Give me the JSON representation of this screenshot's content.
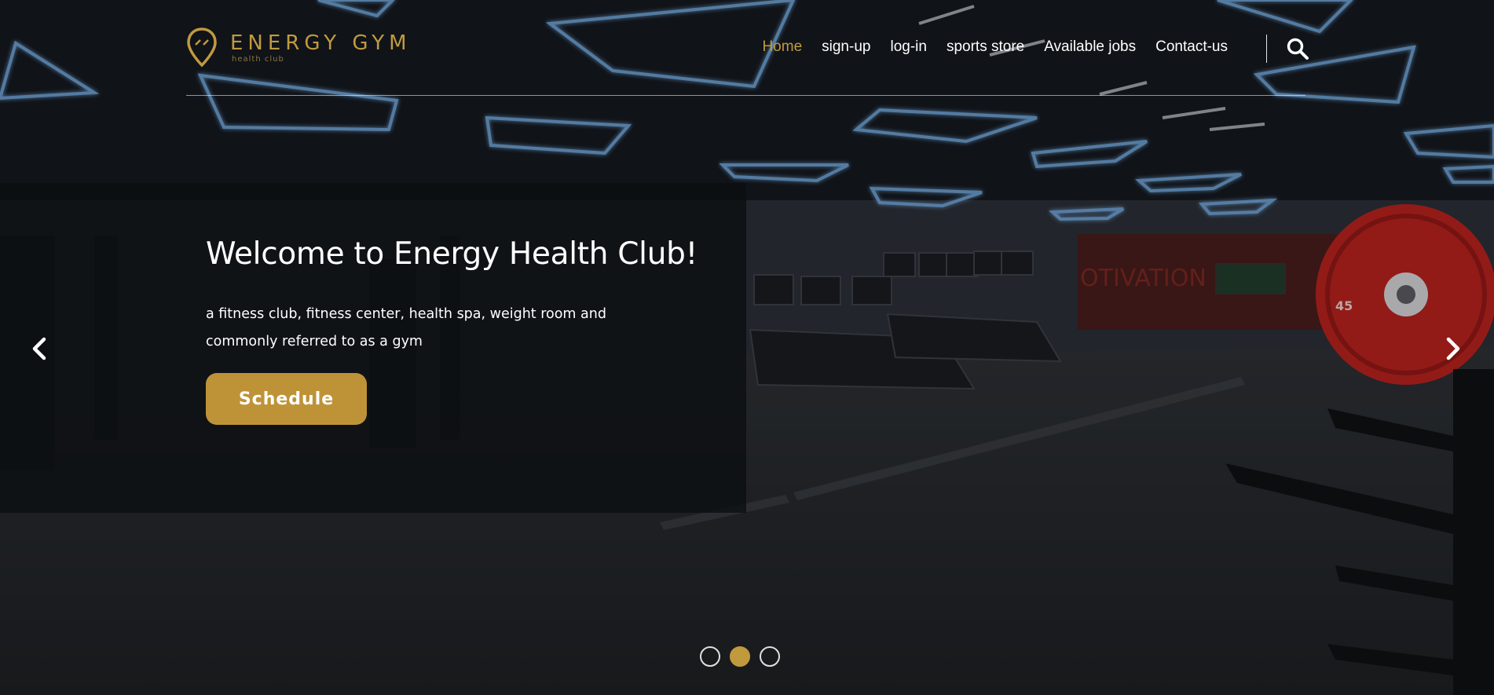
{
  "brand": {
    "name": "ENERGY GYM",
    "subtitle": "health club",
    "accent_color": "#c19a3e"
  },
  "nav": {
    "items": [
      {
        "label": "Home",
        "active": true
      },
      {
        "label": "sign-up",
        "active": false
      },
      {
        "label": "log-in",
        "active": false
      },
      {
        "label": "sports store",
        "active": false
      },
      {
        "label": "Available jobs",
        "active": false
      },
      {
        "label": "Contact-us",
        "active": false
      }
    ],
    "search_icon": "search-icon"
  },
  "hero": {
    "title": "Welcome to Energy Health Club!",
    "description": "a fitness club, fitness center, health spa, weight room and commonly referred to as a gym",
    "cta_label": "Schedule",
    "background_text": "OTIVATION",
    "plate_weight": "45"
  },
  "carousel": {
    "prev_icon": "chevron-left-icon",
    "next_icon": "chevron-right-icon",
    "slide_count": 3,
    "active_slide": 2
  }
}
